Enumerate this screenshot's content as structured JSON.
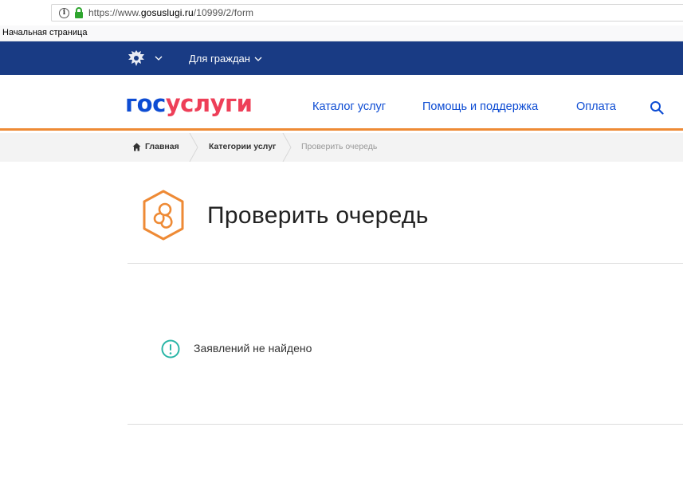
{
  "browser": {
    "url_prefix": "https://www.",
    "url_domain": "gosuslugi.ru",
    "url_path": "/10999/2/form"
  },
  "bookmarks": {
    "items": [
      "Начальная страница"
    ]
  },
  "topnav": {
    "citizens_label": "Для граждан"
  },
  "header": {
    "logo_part1": "гос",
    "logo_part2": "услуги",
    "nav": [
      {
        "label": "Каталог услуг"
      },
      {
        "label": "Помощь и поддержка"
      },
      {
        "label": "Оплата"
      }
    ]
  },
  "breadcrumb": {
    "items": [
      {
        "label": "Главная"
      },
      {
        "label": "Категории услуг"
      },
      {
        "label": "Проверить очередь"
      }
    ]
  },
  "page": {
    "title": "Проверить очередь",
    "notice": "Заявлений не найдено"
  },
  "icons": {
    "info": "info-icon",
    "lock": "lock-icon",
    "emblem": "russian-emblem-icon",
    "search": "search-icon",
    "home": "home-icon",
    "service": "pacifier-icon",
    "notice": "exclamation-circle-icon"
  },
  "colors": {
    "topnav_bg": "#193b84",
    "link_blue": "#0d4cd3",
    "logo_red": "#ee3f58",
    "accent_orange": "#ee8a35",
    "notice_teal": "#2bb6a7"
  }
}
